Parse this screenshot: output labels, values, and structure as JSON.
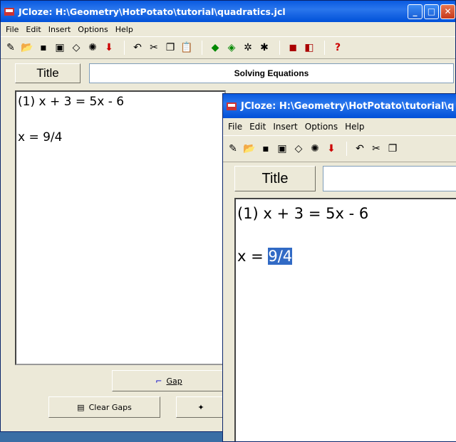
{
  "back": {
    "title": "JCloze: H:\\Geometry\\HotPotato\\tutorial\\quadratics.jcl",
    "menu": [
      "File",
      "Edit",
      "Insert",
      "Options",
      "Help"
    ],
    "title_button": "Title",
    "title_value": "Solving Equations",
    "line1": "(1)  x + 3 = 5x - 6",
    "line2": "x = 9/4",
    "gap_button": "Gap",
    "clear_gaps_button": "Clear Gaps"
  },
  "front": {
    "title": "JCloze: H:\\Geometry\\HotPotato\\tutorial\\q",
    "menu": [
      "File",
      "Edit",
      "Insert",
      "Options",
      "Help"
    ],
    "title_button": "Title",
    "line1": "(1)  x + 3 = 5x - 6",
    "line2_prefix": "x = ",
    "line2_selected": "9/4"
  },
  "colors": {
    "titlebar": "#0a5ae0",
    "selection": "#316ac5",
    "desktop": "#3a6ea5"
  }
}
